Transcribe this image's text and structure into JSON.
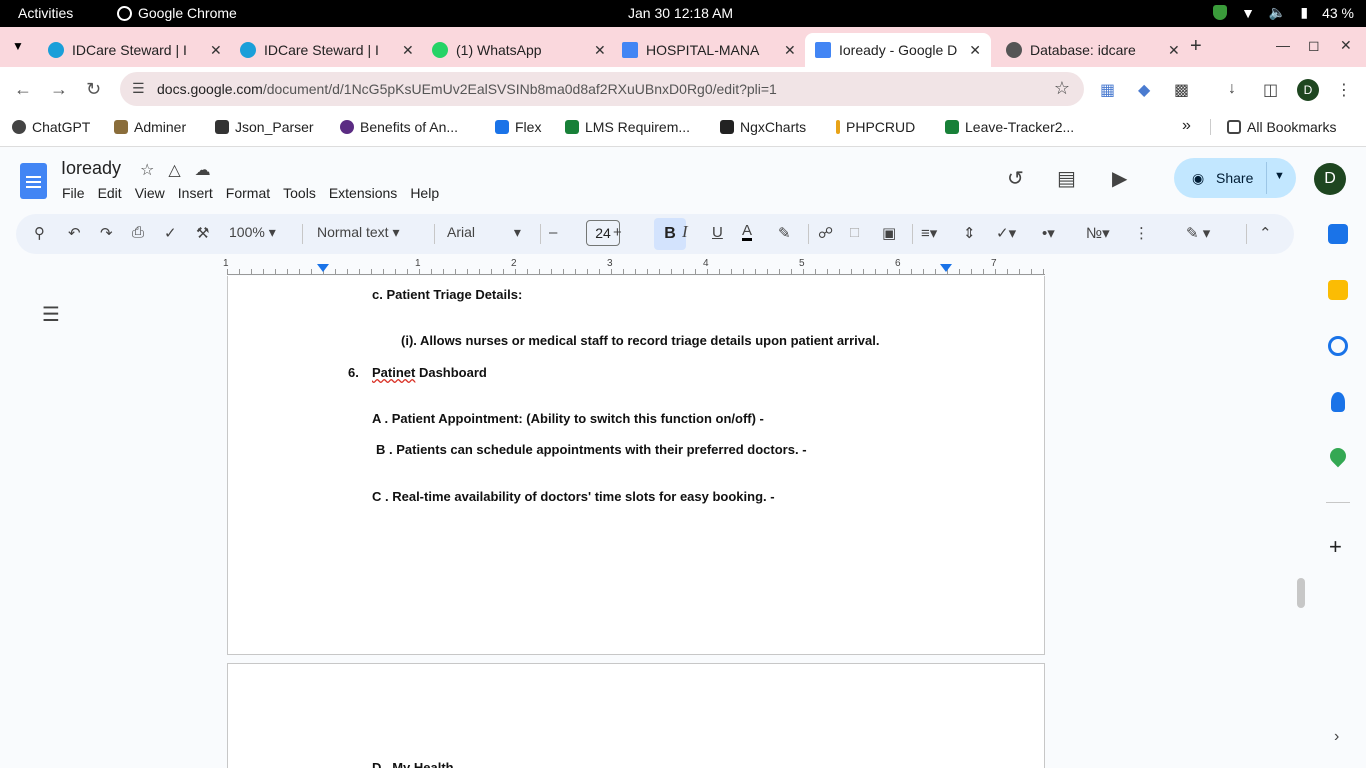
{
  "system": {
    "activities": "Activities",
    "app_name": "Google Chrome",
    "clock": "Jan 30  12:18 AM",
    "battery": "43 %"
  },
  "tabs": [
    {
      "title": "IDCare Steward | I",
      "color": "#1a9fd9",
      "active": false
    },
    {
      "title": "IDCare Steward | I",
      "color": "#1a9fd9",
      "active": false
    },
    {
      "title": "(1) WhatsApp",
      "color": "#25d366",
      "active": false
    },
    {
      "title": "HOSPITAL-MANA",
      "color": "#4285f4",
      "active": false
    },
    {
      "title": "Ioready - Google D",
      "color": "#4285f4",
      "active": true
    },
    {
      "title": "Database: idcare",
      "color": "#555555",
      "active": false
    }
  ],
  "address_bar": {
    "domain": "docs.google.com",
    "path": "/document/d/1NcG5pKsUEmUv2EalSVSINb8ma0d8af2RXuUBnxD0Rg0/edit?pli=1"
  },
  "profile_initial": "D",
  "bookmarks": [
    {
      "label": "ChatGPT",
      "color": "#444444"
    },
    {
      "label": "Adminer",
      "color": "#8a6d3b"
    },
    {
      "label": "Json_Parser",
      "color": "#333333"
    },
    {
      "label": "Benefits of An...",
      "color": "#5b2c83"
    },
    {
      "label": "Flex",
      "color": "#1a73e8"
    },
    {
      "label": "LMS Requirem...",
      "color": "#188038"
    },
    {
      "label": "NgxCharts",
      "color": "#222222"
    },
    {
      "label": "PHPCRUD",
      "color": "#e8a317"
    },
    {
      "label": "Leave-Tracker2...",
      "color": "#188038"
    }
  ],
  "all_bookmarks": "All Bookmarks",
  "doc": {
    "title": "Ioready",
    "menu": [
      "File",
      "Edit",
      "View",
      "Insert",
      "Format",
      "Tools",
      "Extensions",
      "Help"
    ],
    "share_label": "Share"
  },
  "toolbar": {
    "zoom": "100%",
    "style": "Normal text",
    "font": "Arial",
    "font_size": "24",
    "bold": "B",
    "italic": "I",
    "underline": "U",
    "text_color": "A"
  },
  "ruler": [
    "1",
    "1",
    "2",
    "3",
    "4",
    "5",
    "6",
    "7"
  ],
  "content": {
    "line1": "c. Patient Triage Details:",
    "line2": "(i). Allows nurses or medical staff to record triage details upon patient arrival.",
    "item6_num": "6.",
    "item6_word": "Patinet",
    "item6_rest": " Dashboard",
    "lineA": "A . Patient Appointment: (Ability to switch this function on/off) -",
    "lineB": "B . Patients can schedule appointments with their preferred doctors. -",
    "lineC": "C . Real-time availability of doctors' time slots for easy booking. -",
    "lineD": "D . My Health"
  }
}
